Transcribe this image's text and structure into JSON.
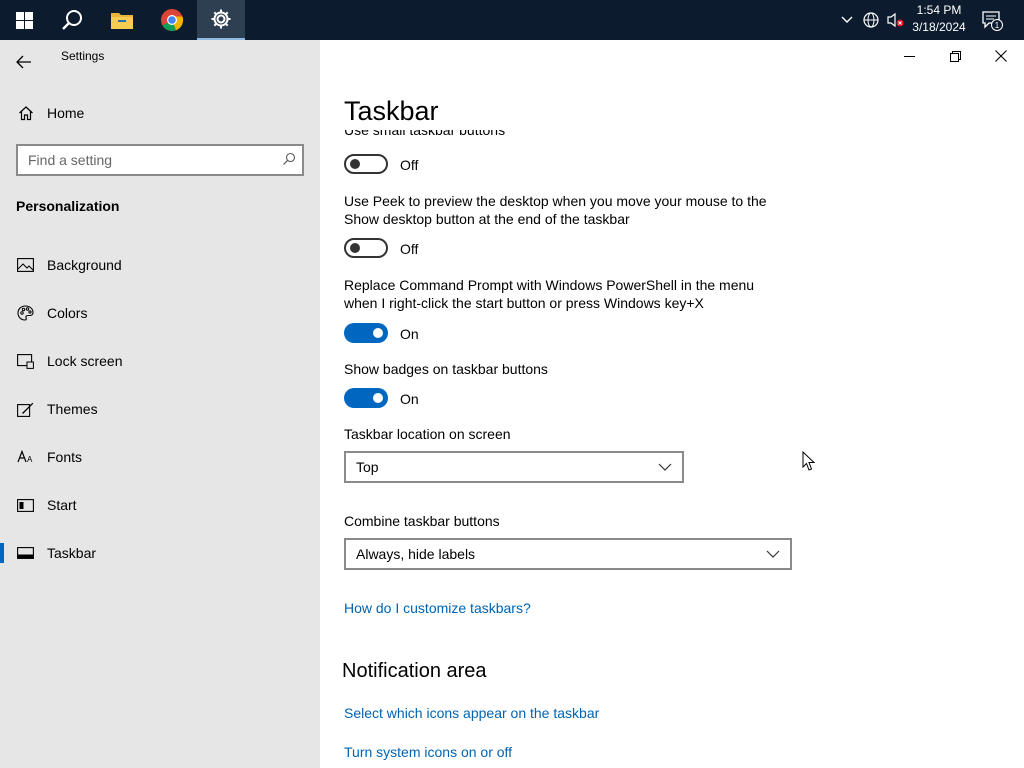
{
  "taskbar": {
    "buttons": [
      "start-icon",
      "search-icon",
      "file-explorer-icon",
      "chrome-icon",
      "settings-icon"
    ],
    "tray": {
      "time": "1:54 PM",
      "date": "3/18/2024",
      "notification_count": "1"
    }
  },
  "window": {
    "app_title": "Settings"
  },
  "nav": {
    "home_label": "Home",
    "search_placeholder": "Find a setting",
    "section_title": "Personalization",
    "items": [
      {
        "label": "Background",
        "icon": "picture-icon"
      },
      {
        "label": "Colors",
        "icon": "palette-icon"
      },
      {
        "label": "Lock screen",
        "icon": "lock-screen-icon"
      },
      {
        "label": "Themes",
        "icon": "brush-icon"
      },
      {
        "label": "Fonts",
        "icon": "font-icon"
      },
      {
        "label": "Start",
        "icon": "start-menu-icon"
      },
      {
        "label": "Taskbar",
        "icon": "taskbar-icon"
      }
    ],
    "selected": "Taskbar"
  },
  "main": {
    "title": "Taskbar",
    "clipped_label": "Use small taskbar buttons",
    "settings": [
      {
        "label": "Use small taskbar buttons",
        "state": "Off",
        "on": false
      },
      {
        "label": "Use Peek to preview the desktop when you move your mouse to the Show desktop button at the end of the taskbar",
        "state": "Off",
        "on": false
      },
      {
        "label": "Replace Command Prompt with Windows PowerShell in the menu when I right-click the start button or press Windows key+X",
        "state": "On",
        "on": true
      },
      {
        "label": "Show badges on taskbar buttons",
        "state": "On",
        "on": true
      }
    ],
    "location": {
      "label": "Taskbar location on screen",
      "value": "Top"
    },
    "combine": {
      "label": "Combine taskbar buttons",
      "value": "Always, hide labels"
    },
    "help_link": "How do I customize taskbars?",
    "notification_area": {
      "heading": "Notification area",
      "links": [
        "Select which icons appear on the taskbar",
        "Turn system icons on or off"
      ]
    }
  },
  "colors": {
    "accent": "#0067c0",
    "link": "#0063b1",
    "taskbar_bg": "#0c1b2e",
    "nav_bg": "#e6e6e6"
  }
}
